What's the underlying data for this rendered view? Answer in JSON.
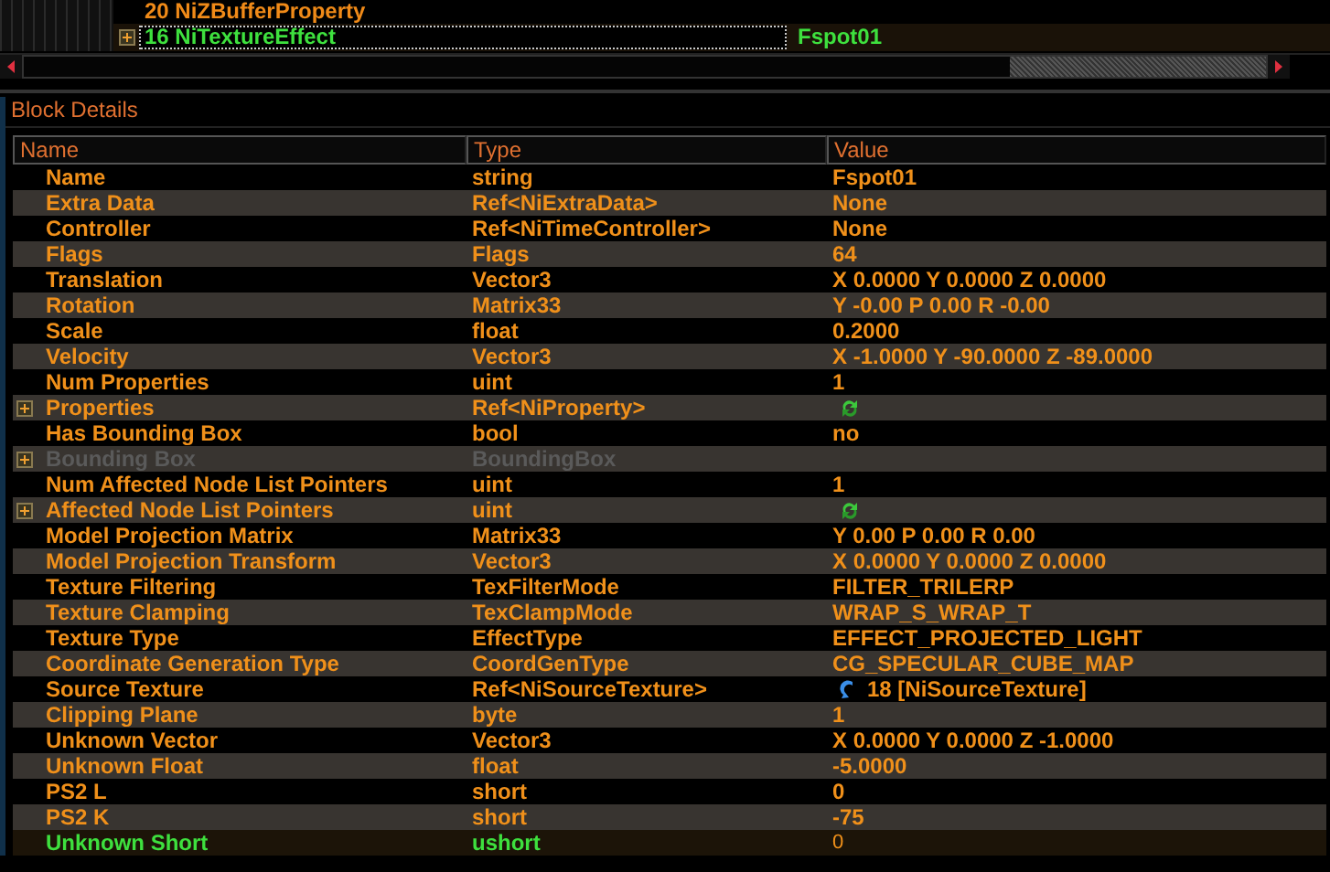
{
  "tree": {
    "rows": [
      {
        "label": "20 NiZBufferProperty",
        "value": "",
        "selected": false,
        "expandable": false
      },
      {
        "label": "16 NiTextureEffect",
        "value": "Fspot01",
        "selected": true,
        "expandable": true
      }
    ]
  },
  "block_details": {
    "title": "Block Details",
    "columns": [
      "Name",
      "Type",
      "Value"
    ],
    "rows": [
      {
        "name": "Name",
        "type": "string",
        "kind": "text",
        "value": "Fspot01",
        "expandable": false,
        "disabled": false,
        "selected": false
      },
      {
        "name": "Extra Data",
        "type": "Ref<NiExtraData>",
        "kind": "text",
        "value": "None",
        "expandable": false,
        "disabled": false,
        "selected": false
      },
      {
        "name": "Controller",
        "type": "Ref<NiTimeController>",
        "kind": "text",
        "value": "None",
        "expandable": false,
        "disabled": false,
        "selected": false
      },
      {
        "name": "Flags",
        "type": "Flags",
        "kind": "text",
        "value": "64",
        "expandable": false,
        "disabled": false,
        "selected": false
      },
      {
        "name": "Translation",
        "type": "Vector3",
        "kind": "text",
        "value": "X 0.0000 Y 0.0000 Z 0.0000",
        "expandable": false,
        "disabled": false,
        "selected": false
      },
      {
        "name": "Rotation",
        "type": "Matrix33",
        "kind": "text",
        "value": "Y -0.00 P 0.00 R -0.00",
        "expandable": false,
        "disabled": false,
        "selected": false
      },
      {
        "name": "Scale",
        "type": "float",
        "kind": "text",
        "value": "0.2000",
        "expandable": false,
        "disabled": false,
        "selected": false
      },
      {
        "name": "Velocity",
        "type": "Vector3",
        "kind": "text",
        "value": "X -1.0000 Y -90.0000 Z -89.0000",
        "expandable": false,
        "disabled": false,
        "selected": false
      },
      {
        "name": "Num Properties",
        "type": "uint",
        "kind": "text",
        "value": "1",
        "expandable": false,
        "disabled": false,
        "selected": false
      },
      {
        "name": "Properties",
        "type": "Ref<NiProperty>",
        "kind": "refresh",
        "expandable": true,
        "disabled": false,
        "selected": false
      },
      {
        "name": "Has Bounding Box",
        "type": "bool",
        "kind": "text",
        "value": "no",
        "expandable": false,
        "disabled": false,
        "selected": false
      },
      {
        "name": "Bounding Box",
        "type": "BoundingBox",
        "kind": "empty",
        "expandable": true,
        "disabled": true,
        "selected": false
      },
      {
        "name": "Num Affected Node List Pointers",
        "type": "uint",
        "kind": "text",
        "value": "1",
        "expandable": false,
        "disabled": false,
        "selected": false
      },
      {
        "name": "Affected Node List Pointers",
        "type": "uint",
        "kind": "refresh",
        "expandable": true,
        "disabled": false,
        "selected": false
      },
      {
        "name": "Model Projection Matrix",
        "type": "Matrix33",
        "kind": "text",
        "value": "Y 0.00 P 0.00 R 0.00",
        "expandable": false,
        "disabled": false,
        "selected": false
      },
      {
        "name": "Model Projection Transform",
        "type": "Vector3",
        "kind": "text",
        "value": "X 0.0000 Y 0.0000 Z 0.0000",
        "expandable": false,
        "disabled": false,
        "selected": false
      },
      {
        "name": "Texture Filtering",
        "type": "TexFilterMode",
        "kind": "text",
        "value": "FILTER_TRILERP",
        "expandable": false,
        "disabled": false,
        "selected": false
      },
      {
        "name": "Texture Clamping",
        "type": "TexClampMode",
        "kind": "text",
        "value": "WRAP_S_WRAP_T",
        "expandable": false,
        "disabled": false,
        "selected": false
      },
      {
        "name": "Texture Type",
        "type": "EffectType",
        "kind": "text",
        "value": "EFFECT_PROJECTED_LIGHT",
        "expandable": false,
        "disabled": false,
        "selected": false
      },
      {
        "name": "Coordinate Generation Type",
        "type": "CoordGenType",
        "kind": "text",
        "value": "CG_SPECULAR_CUBE_MAP",
        "expandable": false,
        "disabled": false,
        "selected": false
      },
      {
        "name": "Source Texture",
        "type": "Ref<NiSourceTexture>",
        "kind": "link",
        "value": "18 [NiSourceTexture]",
        "expandable": false,
        "disabled": false,
        "selected": false
      },
      {
        "name": "Clipping Plane",
        "type": "byte",
        "kind": "text",
        "value": "1",
        "expandable": false,
        "disabled": false,
        "selected": false
      },
      {
        "name": "Unknown Vector",
        "type": "Vector3",
        "kind": "text",
        "value": "X 0.0000 Y 0.0000 Z -1.0000",
        "expandable": false,
        "disabled": false,
        "selected": false
      },
      {
        "name": "Unknown Float",
        "type": "float",
        "kind": "text",
        "value": "-5.0000",
        "expandable": false,
        "disabled": false,
        "selected": false
      },
      {
        "name": "PS2 L",
        "type": "short",
        "kind": "text",
        "value": "0",
        "expandable": false,
        "disabled": false,
        "selected": false
      },
      {
        "name": "PS2 K",
        "type": "short",
        "kind": "text",
        "value": "-75",
        "expandable": false,
        "disabled": false,
        "selected": false
      },
      {
        "name": "Unknown Short",
        "type": "ushort",
        "kind": "text",
        "value": "0",
        "expandable": false,
        "disabled": false,
        "selected": true
      }
    ]
  }
}
